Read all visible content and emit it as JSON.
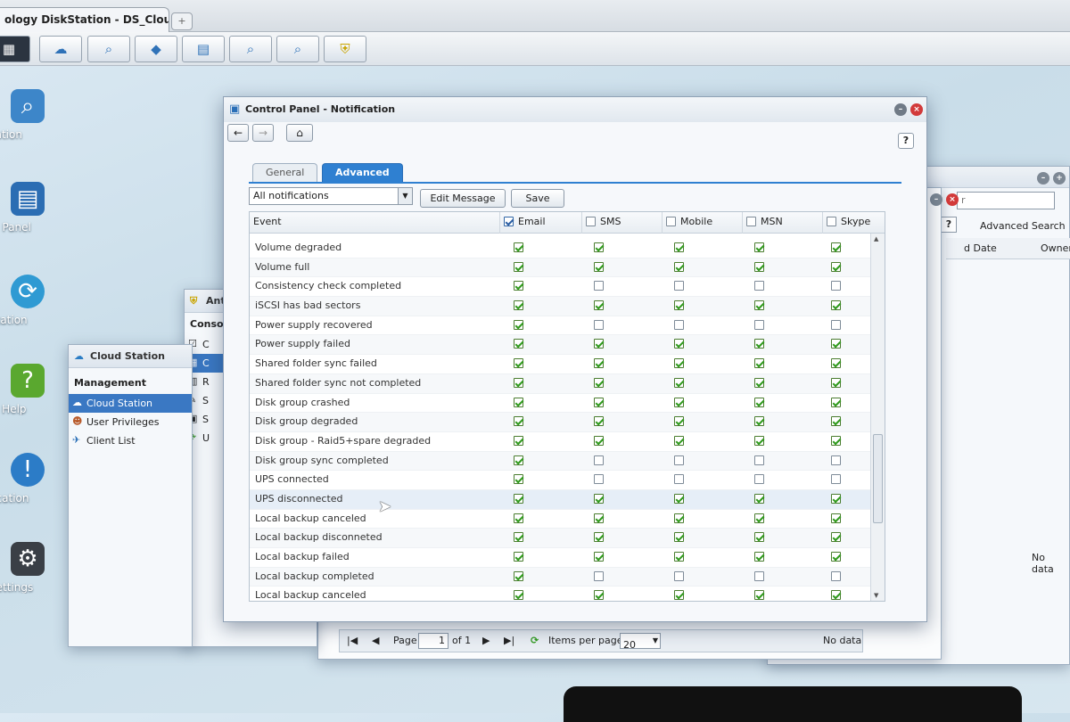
{
  "browser": {
    "tab_title": "ology DiskStation - DS_CloudStati...",
    "new_tab": "+"
  },
  "taskbar": {
    "buttons": [
      "cloud-icon",
      "search-icon",
      "package-icon",
      "panel-icon",
      "search-icon",
      "search-icon",
      "shield-icon"
    ]
  },
  "desktop": {
    "icons": [
      {
        "label": "cation",
        "icon": "search-icon"
      },
      {
        "label": "ol Panel",
        "icon": "control-panel-icon"
      },
      {
        "label": "Station",
        "icon": "cloud-sync-icon"
      },
      {
        "label": "M Help",
        "icon": "help-icon"
      },
      {
        "label": "fication",
        "icon": "notification-icon"
      },
      {
        "label": "Settings",
        "icon": "gear-icon"
      }
    ]
  },
  "cloud_station_window": {
    "title": "Cloud Station",
    "section": "Management",
    "items": [
      "Cloud Station",
      "User Privileges",
      "Client List"
    ]
  },
  "antivirus_window": {
    "title": "Ant",
    "section": "Consol",
    "items": [
      "C",
      "C",
      "R",
      "S",
      "S",
      "U"
    ]
  },
  "right_window": {
    "search_placeholder": "r",
    "help": "?",
    "advanced_search": "Advanced Search",
    "col_date": "d Date",
    "col_owner": "Owner",
    "empty": "No data"
  },
  "pager": {
    "page_label": "Page",
    "page_value": "1",
    "of_label": "of 1",
    "items_label": "Items per page",
    "items_value": "20",
    "empty": "No data"
  },
  "control_panel": {
    "title": "Control Panel - Notification",
    "help": "?",
    "tabs": [
      "General",
      "Advanced"
    ],
    "filter_value": "All notifications",
    "edit_message": "Edit Message",
    "save": "Save",
    "columns": {
      "event": "Event",
      "email": "Email",
      "sms": "SMS",
      "mobile": "Mobile",
      "msn": "MSN",
      "skype": "Skype"
    },
    "header_checks": [
      true,
      false,
      false,
      false,
      false
    ],
    "rows": [
      {
        "event": "Volume degraded",
        "checks": [
          true,
          true,
          true,
          true,
          true
        ]
      },
      {
        "event": "Volume full",
        "checks": [
          true,
          true,
          true,
          true,
          true
        ]
      },
      {
        "event": "Consistency check completed",
        "checks": [
          true,
          false,
          false,
          false,
          false
        ]
      },
      {
        "event": "iSCSI has bad sectors",
        "checks": [
          true,
          true,
          true,
          true,
          true
        ]
      },
      {
        "event": "Power supply recovered",
        "checks": [
          true,
          false,
          false,
          false,
          false
        ]
      },
      {
        "event": "Power supply failed",
        "checks": [
          true,
          true,
          true,
          true,
          true
        ]
      },
      {
        "event": "Shared folder sync failed",
        "checks": [
          true,
          true,
          true,
          true,
          true
        ]
      },
      {
        "event": "Shared folder sync not completed",
        "checks": [
          true,
          true,
          true,
          true,
          true
        ]
      },
      {
        "event": "Disk group crashed",
        "checks": [
          true,
          true,
          true,
          true,
          true
        ]
      },
      {
        "event": "Disk group degraded",
        "checks": [
          true,
          true,
          true,
          true,
          true
        ]
      },
      {
        "event": "Disk group - Raid5+spare degraded",
        "checks": [
          true,
          true,
          true,
          true,
          true
        ]
      },
      {
        "event": "Disk group sync completed",
        "checks": [
          true,
          false,
          false,
          false,
          false
        ]
      },
      {
        "event": "UPS connected",
        "checks": [
          true,
          false,
          false,
          false,
          false
        ]
      },
      {
        "event": "UPS disconnected",
        "checks": [
          true,
          true,
          true,
          true,
          true
        ]
      },
      {
        "event": "Local backup canceled",
        "checks": [
          true,
          true,
          true,
          true,
          true
        ]
      },
      {
        "event": "Local backup disconneted",
        "checks": [
          true,
          true,
          true,
          true,
          true
        ]
      },
      {
        "event": "Local backup failed",
        "checks": [
          true,
          true,
          true,
          true,
          true
        ]
      },
      {
        "event": "Local backup completed",
        "checks": [
          true,
          false,
          false,
          false,
          false
        ]
      },
      {
        "event": "Local backup canceled",
        "checks": [
          true,
          true,
          true,
          true,
          true
        ]
      }
    ]
  }
}
